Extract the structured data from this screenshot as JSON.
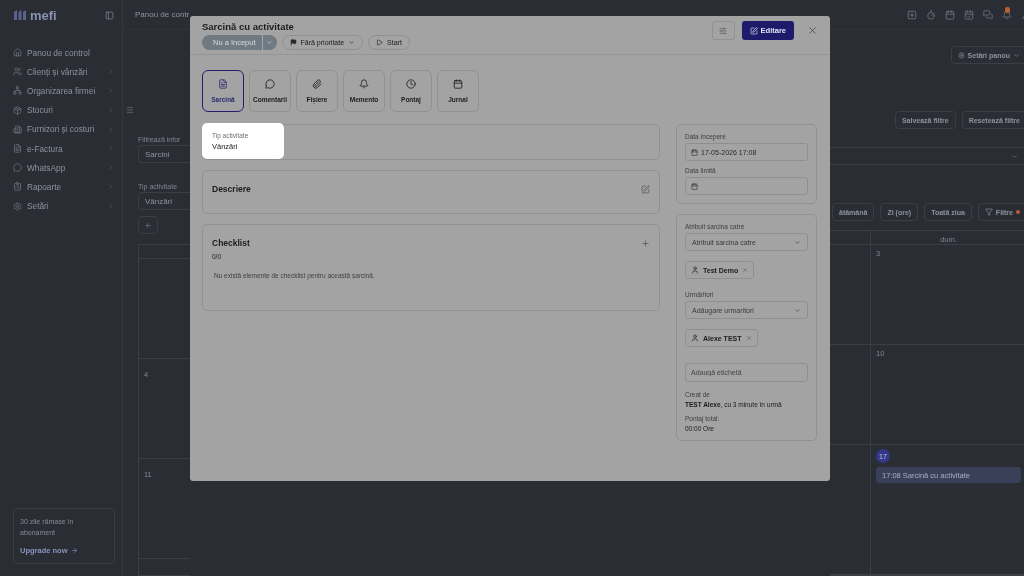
{
  "sidebar": {
    "logo": "mefi",
    "items": [
      {
        "label": "Panou de control",
        "has_submenu": false
      },
      {
        "label": "Clienți și vânzări",
        "has_submenu": true
      },
      {
        "label": "Organizarea firmei",
        "has_submenu": true
      },
      {
        "label": "Stocuri",
        "has_submenu": true
      },
      {
        "label": "Furnizori și costuri",
        "has_submenu": true
      },
      {
        "label": "e-Factura",
        "has_submenu": true
      },
      {
        "label": "WhatsApp",
        "has_submenu": true
      },
      {
        "label": "Rapoarte",
        "has_submenu": true
      },
      {
        "label": "Setări",
        "has_submenu": true
      }
    ],
    "trial": {
      "text": "30 zile rămase în abonament",
      "link": "Upgrade now"
    }
  },
  "topbar": {
    "breadcrumb": "Panou de contr",
    "notifications": true
  },
  "background_left": {
    "filter_label": "Filtrează infor",
    "filter_value": "Sarcini",
    "type_label": "Tip activitate",
    "type_value": "Vânzări",
    "week_numbers": [
      "4",
      "11"
    ]
  },
  "background_right": {
    "settings_button": "Setări panou",
    "save_filters": "Salvează filtre",
    "reset_filters": "Resetează filtre",
    "views": [
      {
        "label": "ătămână"
      },
      {
        "label": "Zi (ore)"
      },
      {
        "label": "Toată ziua"
      }
    ],
    "filter_button": "Filtre",
    "filters_active": true,
    "day_header": "dum.",
    "days": [
      "3",
      "10"
    ],
    "today": "17",
    "event": "17:08 Sarcină cu activitate"
  },
  "modal": {
    "title": "Sarcină cu activitate",
    "status": "Nu a început",
    "priority": "Fără prioritate",
    "start": "Start",
    "edit": "Editare",
    "tabs": [
      {
        "label": "Sarcină",
        "selected": true
      },
      {
        "label": "Comentarii",
        "selected": false
      },
      {
        "label": "Fișiere",
        "selected": false
      },
      {
        "label": "Memento",
        "selected": false
      },
      {
        "label": "Pontaj",
        "selected": false
      },
      {
        "label": "Jurnal",
        "selected": false
      }
    ],
    "activity_type": {
      "label": "Tip activitate",
      "value": "Vânzări"
    },
    "description": {
      "title": "Descriere"
    },
    "checklist": {
      "title": "Checklist",
      "count": "0/0",
      "empty": "Nu există elemente de checklist pentru această sarcină."
    },
    "start_date": {
      "label": "Data începere",
      "value": "17-05-2026 17:08"
    },
    "due_date": {
      "label": "Data limită"
    },
    "assignee": {
      "label": "Atribuit sarcina catre",
      "placeholder": "Atribuit sarcina catre",
      "chip": "Test Demo"
    },
    "followers": {
      "label": "Urmăritori",
      "placeholder": "Adăugare urmaritori",
      "chip": "Alexe TEST"
    },
    "tag": {
      "placeholder": "Adaugă etichetă"
    },
    "created": {
      "label": "Creat de",
      "value": "**TEST Alexe**, cu 3 minute în urmă"
    },
    "time": {
      "label": "Pontaj total:",
      "value": "00:00 Ore"
    }
  }
}
